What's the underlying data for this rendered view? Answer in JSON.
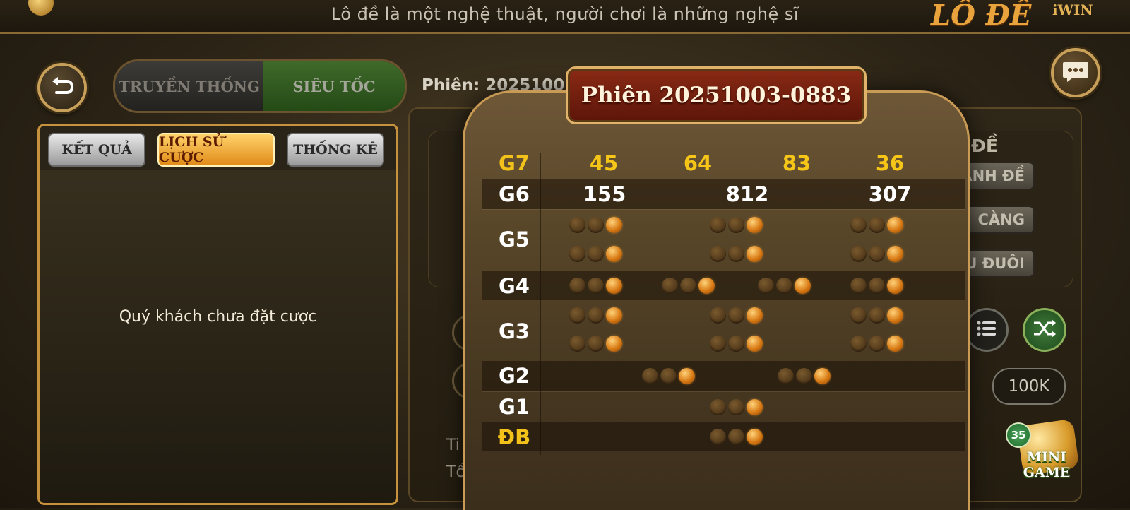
{
  "marquee": "Lô đề là một nghệ thuật, người chơi là những nghệ sĩ",
  "brand": {
    "logo_text": "LÔ ĐỀ",
    "partner_text": "iWIN"
  },
  "mode_tabs": [
    {
      "label": "TRUYỀN THỐNG",
      "active": false
    },
    {
      "label": "SIÊU TỐC",
      "active": true
    }
  ],
  "session_label": "Phiên: 2025100",
  "left_panel": {
    "tabs": [
      {
        "label": "KẾT QUẢ",
        "active": false
      },
      {
        "label": "LỊCH SỬ CƯỢC",
        "active": true
      },
      {
        "label": "THỐNG KÊ",
        "active": false
      }
    ],
    "empty_message": "Quý khách chưa đặt cược"
  },
  "background_panel": {
    "side_title": "ĐỀ",
    "side_buttons": [
      "ANH ĐỀ",
      "CÀNG",
      "U ĐUÔI"
    ],
    "chip": "100K",
    "left_text_1": "Ti",
    "left_text_2": "Tổng"
  },
  "mini_game": {
    "badge": "35",
    "label_line1": "MINI",
    "label_line2": "GAME"
  },
  "modal": {
    "title": "Phiên 20251003-0883",
    "rows": [
      {
        "prize": "G7",
        "values": [
          "45",
          "64",
          "83",
          "36"
        ]
      },
      {
        "prize": "G6",
        "values": [
          "155",
          "812",
          "307"
        ]
      },
      {
        "prize": "G5",
        "hidden_groups": 6
      },
      {
        "prize": "G4",
        "hidden_groups": 4
      },
      {
        "prize": "G3",
        "hidden_groups": 6
      },
      {
        "prize": "G2",
        "hidden_groups": 2
      },
      {
        "prize": "G1",
        "hidden_groups": 1
      },
      {
        "prize": "ĐB",
        "hidden_groups": 1
      }
    ]
  },
  "colors": {
    "gold_number": "#f5c518",
    "active_tab_gold": "#f0a326",
    "modal_border": "#c99b55",
    "title_red": "#7a2210"
  },
  "icons": [
    "back-arrow-icon",
    "chat-bubble-icon",
    "list-icon",
    "shuffle-icon",
    "dice-icon"
  ]
}
